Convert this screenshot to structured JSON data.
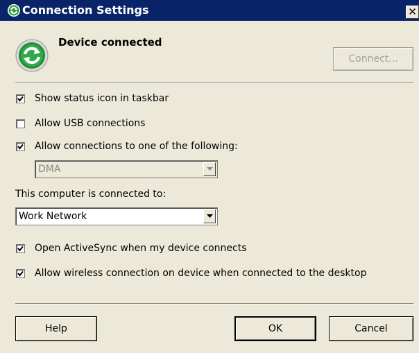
{
  "window": {
    "title": "Connection Settings",
    "close_label": "✕"
  },
  "status": {
    "text": "Device connected",
    "connect_button": "Connect..."
  },
  "options": {
    "show_status_icon": {
      "label": "Show status icon in taskbar",
      "checked": true
    },
    "allow_usb": {
      "label": "Allow USB connections",
      "checked": false
    },
    "allow_connections": {
      "label": "Allow connections to one of the following:",
      "checked": true
    }
  },
  "connection_type": {
    "value": "DMA",
    "enabled": false
  },
  "computer_connected": {
    "label": "This computer is connected to:",
    "value": "Work Network"
  },
  "more_options": {
    "open_activesync": {
      "label": "Open ActiveSync when my device connects",
      "checked": true
    },
    "allow_wireless": {
      "label": "Allow wireless connection on device when connected to the desktop",
      "checked": true
    }
  },
  "buttons": {
    "help": "Help",
    "ok": "OK",
    "cancel": "Cancel"
  }
}
